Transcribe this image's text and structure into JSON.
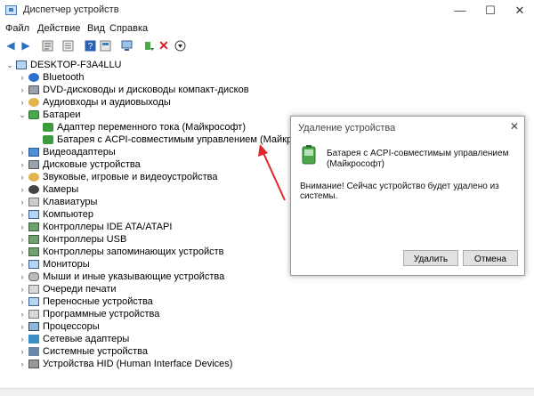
{
  "window": {
    "title": "Диспетчер устройств",
    "controls": {
      "minimize": "—",
      "maximize": "☐",
      "close": "✕"
    }
  },
  "menu": [
    "Файл",
    "Действие",
    "Вид",
    "Справка"
  ],
  "toolbar_icons": [
    "back-arrow-icon",
    "forward-arrow-icon",
    "properties-icon",
    "list-icon",
    "help-icon",
    "device-view-icon",
    "scan-hardware-icon",
    "update-driver-icon",
    "uninstall-x-icon",
    "download-icon"
  ],
  "tree": {
    "root": "DESKTOP-F3A4LLU",
    "categories": [
      {
        "label": "Bluetooth",
        "icon": "bluetooth-icon",
        "expanded": false
      },
      {
        "label": "DVD-дисководы и дисководы компакт-дисков",
        "icon": "dvd-drive-icon",
        "expanded": false
      },
      {
        "label": "Аудиовходы и аудиовыходы",
        "icon": "audio-icon",
        "expanded": false
      },
      {
        "label": "Батареи",
        "icon": "battery-icon",
        "expanded": true,
        "children": [
          "Адаптер переменного тока (Майкрософт)",
          "Батарея с ACPI-совместимым управлением (Майкрософт)"
        ]
      },
      {
        "label": "Видеоадаптеры",
        "icon": "display-adapter-icon",
        "expanded": false
      },
      {
        "label": "Дисковые устройства",
        "icon": "disk-drive-icon",
        "expanded": false
      },
      {
        "label": "Звуковые, игровые и видеоустройства",
        "icon": "sound-icon",
        "expanded": false
      },
      {
        "label": "Камеры",
        "icon": "camera-icon",
        "expanded": false
      },
      {
        "label": "Клавиатуры",
        "icon": "keyboard-icon",
        "expanded": false
      },
      {
        "label": "Компьютер",
        "icon": "computer-icon",
        "expanded": false
      },
      {
        "label": "Контроллеры IDE ATA/ATAPI",
        "icon": "ide-controller-icon",
        "expanded": false
      },
      {
        "label": "Контроллеры USB",
        "icon": "usb-controller-icon",
        "expanded": false
      },
      {
        "label": "Контроллеры запоминающих устройств",
        "icon": "storage-controller-icon",
        "expanded": false
      },
      {
        "label": "Мониторы",
        "icon": "monitor-icon",
        "expanded": false
      },
      {
        "label": "Мыши и иные указывающие устройства",
        "icon": "mouse-icon",
        "expanded": false
      },
      {
        "label": "Очереди печати",
        "icon": "print-queue-icon",
        "expanded": false
      },
      {
        "label": "Переносные устройства",
        "icon": "portable-device-icon",
        "expanded": false
      },
      {
        "label": "Программные устройства",
        "icon": "software-device-icon",
        "expanded": false
      },
      {
        "label": "Процессоры",
        "icon": "processor-icon",
        "expanded": false
      },
      {
        "label": "Сетевые адаптеры",
        "icon": "network-adapter-icon",
        "expanded": false
      },
      {
        "label": "Системные устройства",
        "icon": "system-device-icon",
        "expanded": false
      },
      {
        "label": "Устройства HID (Human Interface Devices)",
        "icon": "hid-icon",
        "expanded": false
      }
    ]
  },
  "dialog": {
    "title": "Удаление устройства",
    "device_name": "Батарея с ACPI-совместимым управлением (Майкрософт)",
    "warning": "Внимание! Сейчас устройство будет удалено из системы.",
    "ok_label": "Удалить",
    "cancel_label": "Отмена"
  },
  "colors": {
    "arrow": "#e0252b",
    "accent": "#2d6fcf"
  }
}
